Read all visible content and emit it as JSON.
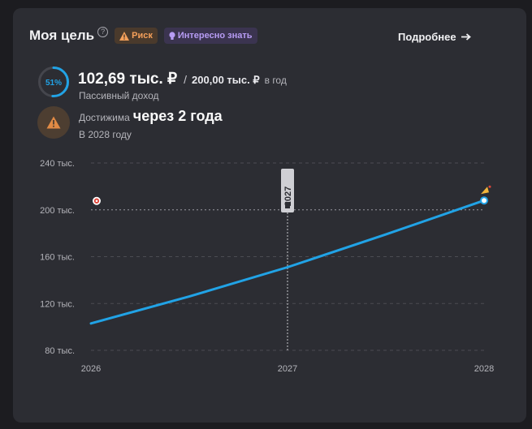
{
  "header": {
    "title": "Моя цель",
    "help": "?",
    "risk_label": "Риск",
    "info_label": "Интересно знать",
    "more_label": "Подробнее"
  },
  "progress": {
    "percent_label": "51%",
    "fraction": 0.51,
    "current": "102,69 тыс. ₽",
    "separator": "/",
    "goal": "200,00 тыс. ₽",
    "period": "в год",
    "caption": "Пассивный доход"
  },
  "reach": {
    "prefix": "Достижима",
    "value": "через 2 года",
    "caption": "В 2028 году"
  },
  "colors": {
    "accent": "#21a3e6",
    "risk": "#f5a05a",
    "info": "#b79cf4",
    "card": "#2c2d33"
  },
  "chart_data": {
    "type": "line",
    "x_ticks": [
      "2026",
      "2027",
      "2028"
    ],
    "y_ticks": [
      "240 тыс.",
      "200 тыс.",
      "160 тыс.",
      "120 тыс.",
      "80 тыс."
    ],
    "y_tick_values": [
      240,
      200,
      160,
      120,
      80
    ],
    "ylim": [
      80,
      240
    ],
    "xlim": [
      2026,
      2028
    ],
    "series": [
      {
        "x": [
          2026,
          2026.5,
          2027,
          2027.5,
          2028
        ],
        "y": [
          103,
          126,
          151,
          179,
          208
        ]
      }
    ],
    "goal_value": 200,
    "marker_label": "2027",
    "marker_x": 2027,
    "grid": true
  }
}
